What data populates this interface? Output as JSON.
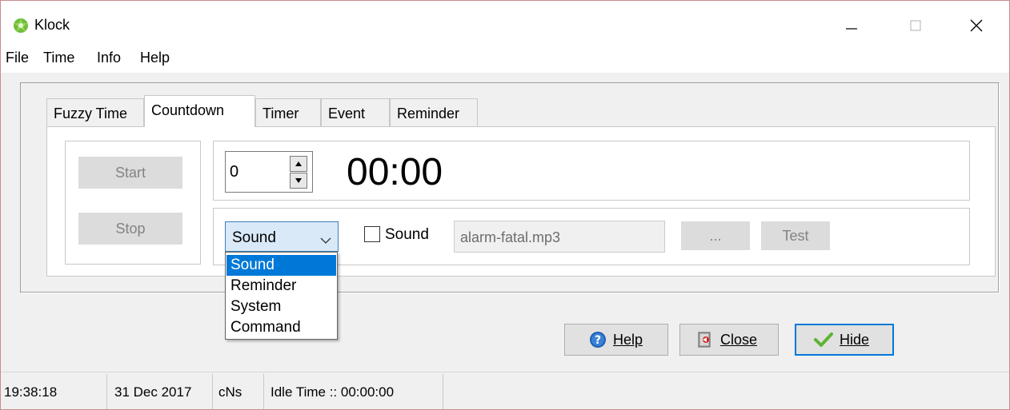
{
  "window": {
    "title": "Klock",
    "icon": "clock-leaf-icon"
  },
  "menu": [
    "File",
    "Time",
    "Info",
    "Help"
  ],
  "tabs": [
    {
      "label": "Fuzzy Time"
    },
    {
      "label": "Countdown",
      "active": true
    },
    {
      "label": "Timer"
    },
    {
      "label": "Event"
    },
    {
      "label": "Reminder"
    }
  ],
  "countdown": {
    "start_label": "Start",
    "stop_label": "Stop",
    "spin_value": "0",
    "time_display": "00:00",
    "action_type": {
      "selected": "Sound",
      "options": [
        "Sound",
        "Reminder",
        "System",
        "Command"
      ]
    },
    "sound_checkbox": {
      "label": "Sound",
      "checked": false
    },
    "sound_file": "alarm-fatal.mp3",
    "browse_label": "...",
    "test_label": "Test"
  },
  "buttons": {
    "help": "Help",
    "close": "Close",
    "hide": "Hide"
  },
  "status": {
    "time": "19:38:18",
    "date": "31 Dec 2017",
    "flags": "cNs",
    "idle": "Idle Time :: 00:00:00"
  },
  "colors": {
    "accent": "#0078d7",
    "hide_border": "#0078d7",
    "check_green": "#5fb233"
  }
}
